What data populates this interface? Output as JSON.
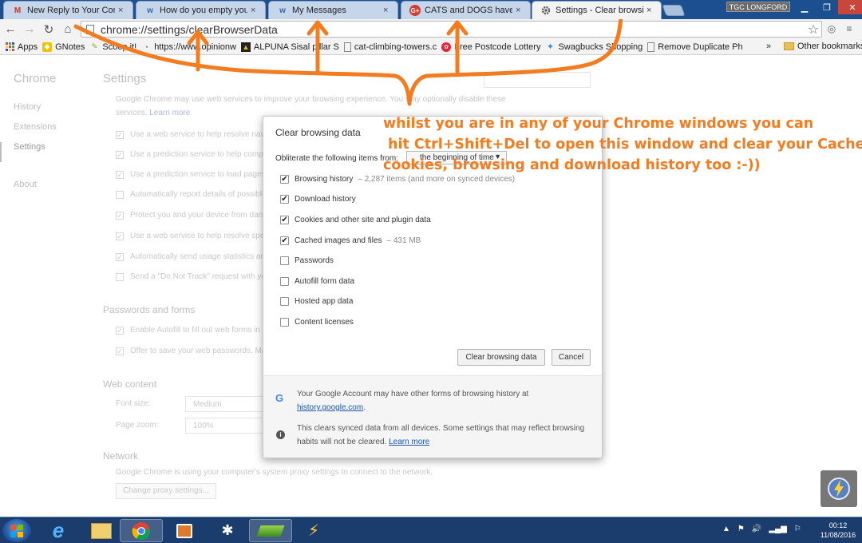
{
  "tabs": [
    {
      "title": "New Reply to Your Comm",
      "favicon": "gmail-icon",
      "accent": "#d93025"
    },
    {
      "title": "How do you empty your c",
      "favicon": "wa-icon",
      "accent": "#3367b0"
    },
    {
      "title": "My Messages",
      "favicon": "wa-icon",
      "accent": "#3367b0"
    },
    {
      "title": "CATS and DOGS have FUN",
      "favicon": "google-plus-icon",
      "accent": "#d23f31"
    },
    {
      "title": "Settings - Clear browsing",
      "favicon": "gear-icon",
      "accent": "#555555"
    }
  ],
  "profile_name": "TGC LONGFORD",
  "omnibox": {
    "url_prefix": "chrome://",
    "url_strong": "settings",
    "url_suffix": "/clearBrowserData"
  },
  "bookmarks": [
    {
      "label": "Apps",
      "icon": "apps-grid-icon"
    },
    {
      "label": "GNotes",
      "icon": "gnotes-icon"
    },
    {
      "label": "Scoop.it!",
      "icon": "scoopit-icon"
    },
    {
      "label": "https://www.opinionw",
      "icon": "opinion-icon"
    },
    {
      "label": "ALPUNA Sisal pillar S",
      "icon": "alpuna-icon"
    },
    {
      "label": "cat-climbing-towers.c",
      "icon": "page-icon"
    },
    {
      "label": "Free Postcode Lottery",
      "icon": "postcode-icon"
    },
    {
      "label": "Swagbucks Shopping",
      "icon": "swagbucks-icon"
    },
    {
      "label": "Remove Duplicate Ph",
      "icon": "page-icon"
    }
  ],
  "bookmarks_more": "»",
  "other_bookmarks": "Other bookmarks",
  "settings": {
    "app_title": "Chrome",
    "nav": [
      "History",
      "Extensions",
      "Settings",
      "About"
    ],
    "title": "Settings",
    "privacy_desc": "Google Chrome may use web services to improve your browsing experience. You may optionally disable these services.",
    "learn_more": "Learn more",
    "privacy_options": [
      "Use a web service to help resolve navigation errors",
      "Use a prediction service to help complete searches and URLs typed in the address bar",
      "Use a prediction service to load pages more quickly",
      "Automatically report details of possible security incidents to Google",
      "Protect you and your device from dangerous sites",
      "Use a web service to help resolve spelling errors",
      "Automatically send usage statistics and crash reports to Google",
      "Send a \"Do Not Track\" request with your browsing traffic"
    ],
    "privacy_checked": [
      true,
      true,
      true,
      false,
      true,
      true,
      true,
      false
    ],
    "passwords_heading": "Passwords and forms",
    "password_options": [
      "Enable Autofill to fill out web forms in a single click",
      "Offer to save your web passwords. Manage passwords"
    ],
    "web_content_heading": "Web content",
    "font_size_label": "Font size:",
    "font_size_value": "Medium",
    "page_zoom_label": "Page zoom:",
    "page_zoom_value": "100%",
    "network_heading": "Network",
    "network_desc": "Google Chrome is using your computer's system proxy settings to connect to the network.",
    "proxy_button": "Change proxy settings..."
  },
  "dialog": {
    "title": "Clear browsing data",
    "obliterate_label": "Obliterate the following items from:",
    "time_range": "the beginning of time",
    "items": [
      {
        "label": "Browsing history",
        "checked": true,
        "note": "– 2,287 items (and more on synced devices)"
      },
      {
        "label": "Download history",
        "checked": true,
        "note": ""
      },
      {
        "label": "Cookies and other site and plugin data",
        "checked": true,
        "note": ""
      },
      {
        "label": "Cached images and files",
        "checked": true,
        "note": "– 431 MB"
      },
      {
        "label": "Passwords",
        "checked": false,
        "note": ""
      },
      {
        "label": "Autofill form data",
        "checked": false,
        "note": ""
      },
      {
        "label": "Hosted app data",
        "checked": false,
        "note": ""
      },
      {
        "label": "Content licenses",
        "checked": false,
        "note": ""
      }
    ],
    "clear_button": "Clear browsing data",
    "cancel_button": "Cancel",
    "footer_account": "Your Google Account may have other forms of browsing history at",
    "footer_account_link": "history.google.com",
    "footer_sync": "This clears synced data from all devices. Some settings that may reflect browsing habits will not be cleared.",
    "footer_learn_more": "Learn more"
  },
  "annotation": {
    "line1": "whilst you are in any of your Chrome windows you can",
    "line2": "hit Ctrl+Shift+Del to open this window and clear your Cache",
    "line3": "cookies, browsing and download history too :-))",
    "color": "#f47c20"
  },
  "taskbar": {
    "apps": [
      "start-orb-icon",
      "ie-icon",
      "explorer-icon",
      "chrome-icon",
      "media-player-icon",
      "bluetooth-icon",
      "bluestacks-icon",
      "lightning-app-icon"
    ],
    "time": "00:12",
    "date": "11/08/2016"
  },
  "colors": {
    "taskbar": "#1b3d6e",
    "tabstrip": "#1c4f8f",
    "link": "#1a55b8"
  }
}
